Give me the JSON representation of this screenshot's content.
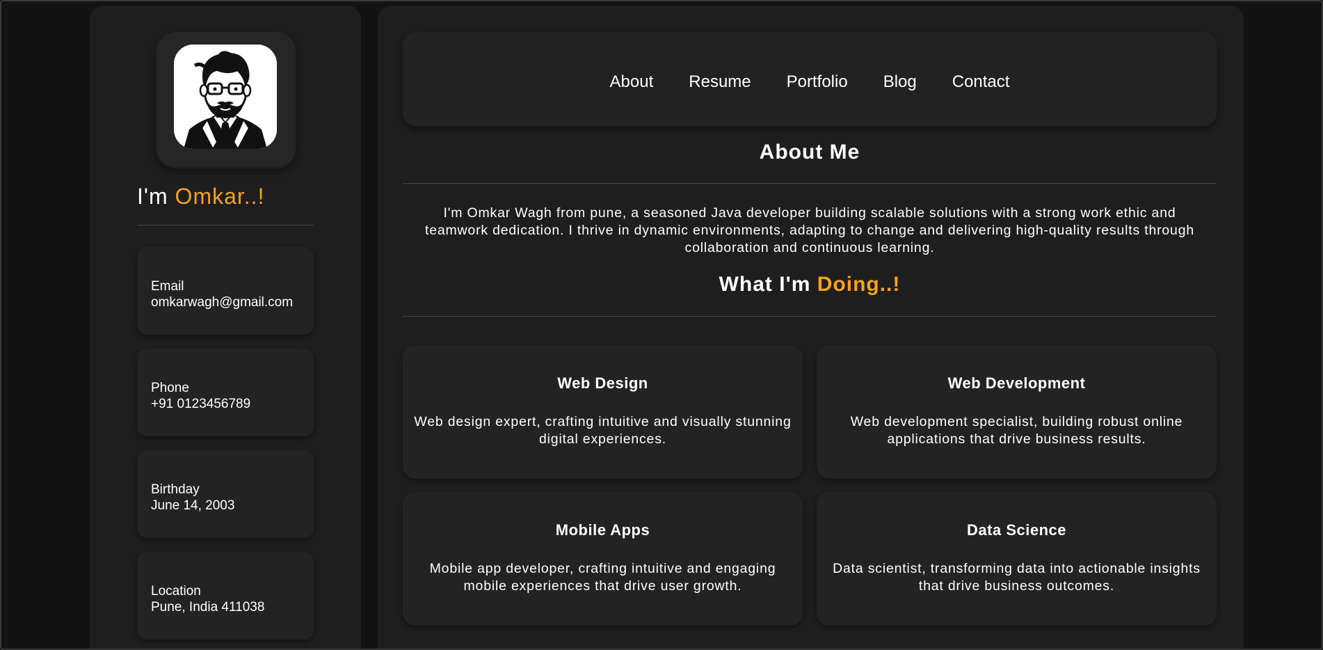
{
  "sidebar": {
    "name_prefix": "I'm ",
    "name_accent": "Omkar..!",
    "contacts": [
      {
        "label": "Email",
        "value": "omkarwagh@gmail.com"
      },
      {
        "label": "Phone",
        "value": "+91 0123456789"
      },
      {
        "label": "Birthday",
        "value": "June 14, 2003"
      },
      {
        "label": "Location",
        "value": "Pune, India 411038"
      }
    ]
  },
  "nav": {
    "items": [
      "About",
      "Resume",
      "Portfolio",
      "Blog",
      "Contact"
    ]
  },
  "about": {
    "title": "About Me",
    "text": "I'm Omkar Wagh from pune, a seasoned Java developer building scalable solutions with a strong work ethic and teamwork dedication. I thrive in dynamic environments, adapting to change and delivering high-quality results through collaboration and continuous learning."
  },
  "doing": {
    "title_prefix": "What I'm ",
    "title_accent": "Doing..!",
    "services": [
      {
        "title": "Web Design",
        "desc": "Web design expert, crafting intuitive and visually stunning digital experiences."
      },
      {
        "title": "Web Development",
        "desc": "Web development specialist, building robust online applications that drive business results."
      },
      {
        "title": "Mobile Apps",
        "desc": "Mobile app developer, crafting intuitive and engaging mobile experiences that drive user growth."
      },
      {
        "title": "Data Science",
        "desc": "Data scientist, transforming data into actionable insights that drive business outcomes."
      }
    ]
  },
  "colors": {
    "accent": "#f5a31a",
    "page_bg": "#121212",
    "panel_bg": "#1e1e1e",
    "card_bg": "#232323"
  }
}
